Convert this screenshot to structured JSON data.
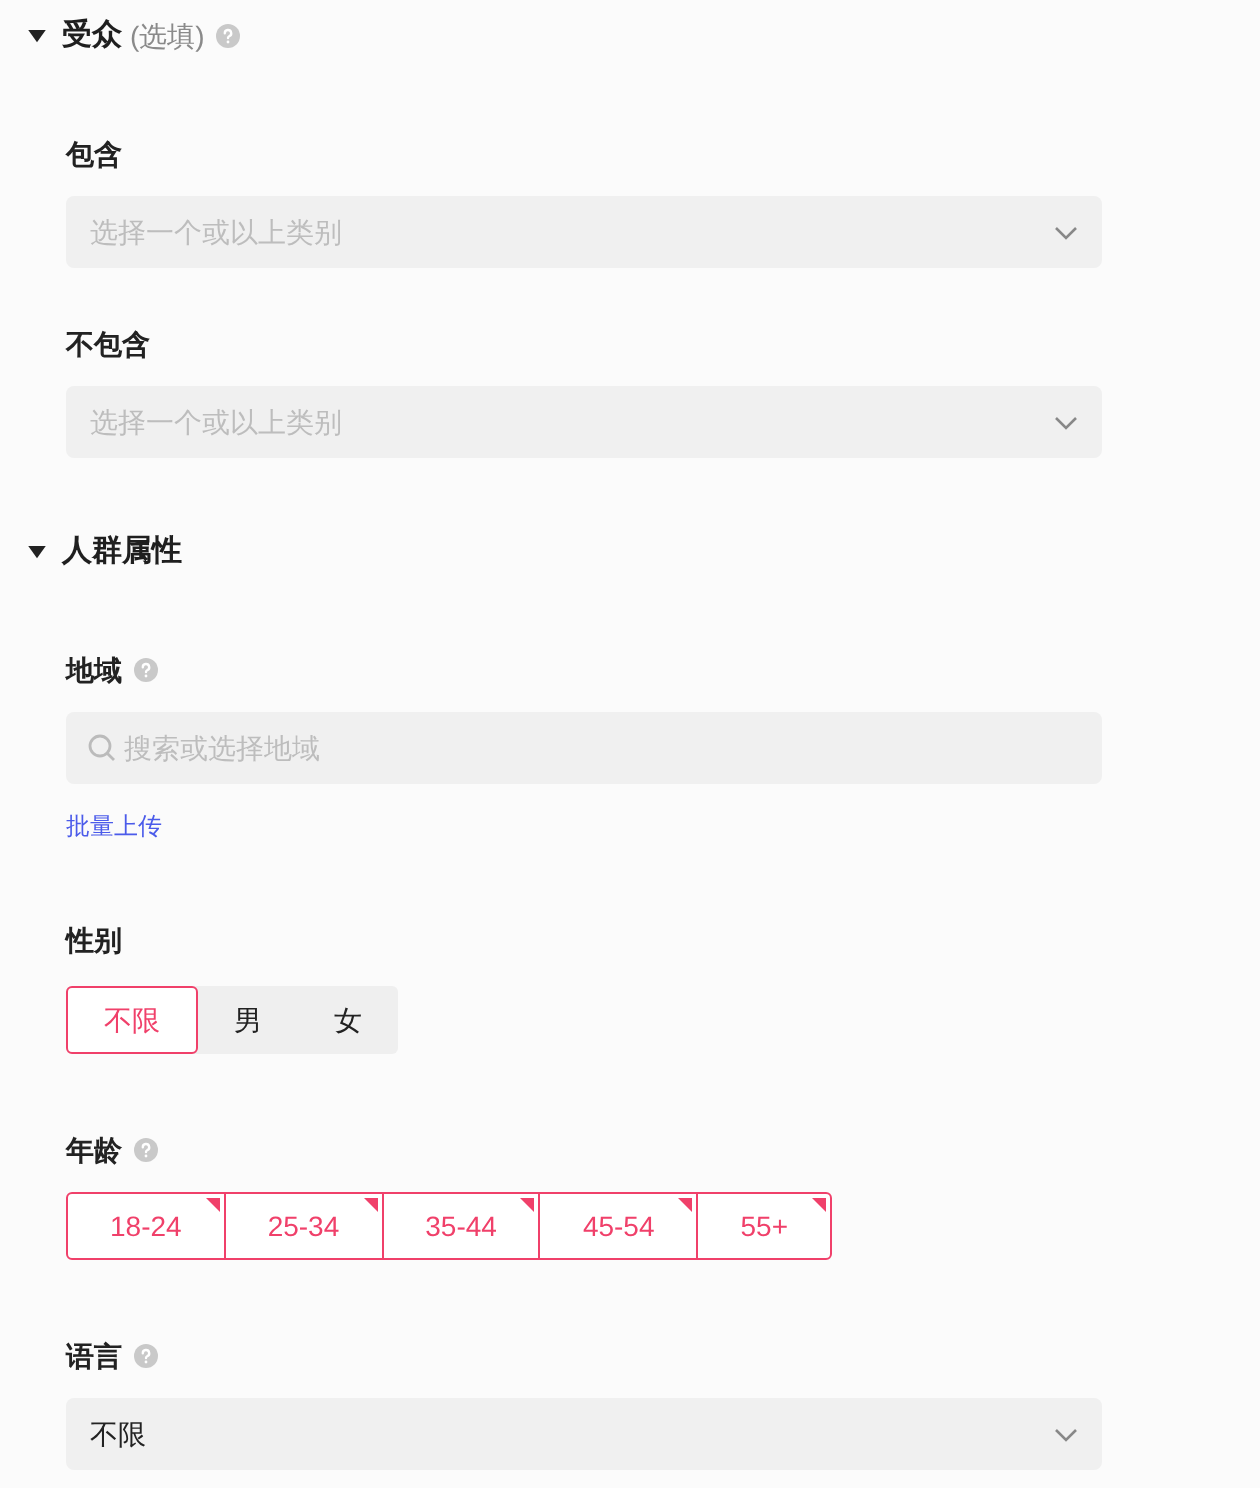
{
  "sections": [
    {
      "title": "受众",
      "note": "(选填)",
      "help": true,
      "expanded": true,
      "fields": [
        {
          "kind": "select",
          "label": "包含",
          "help": false,
          "placeholder": "选择一个或以上类别"
        },
        {
          "kind": "select",
          "label": "不包含",
          "help": false,
          "placeholder": "选择一个或以上类别"
        }
      ]
    },
    {
      "title": "人群属性",
      "help": false,
      "expanded": true,
      "fields": [
        {
          "kind": "search",
          "label": "地域",
          "help": true,
          "placeholder": "搜索或选择地域",
          "link": "批量上传"
        },
        {
          "kind": "segmented",
          "label": "性别",
          "help": false,
          "options": [
            {
              "label": "不限",
              "selected": true
            },
            {
              "label": "男",
              "selected": false
            },
            {
              "label": "女",
              "selected": false
            }
          ]
        },
        {
          "kind": "multi",
          "label": "年龄",
          "help": true,
          "options": [
            {
              "label": "18-24",
              "selected": true
            },
            {
              "label": "25-34",
              "selected": true
            },
            {
              "label": "35-44",
              "selected": true
            },
            {
              "label": "45-54",
              "selected": true
            },
            {
              "label": "55+",
              "selected": true
            }
          ]
        },
        {
          "kind": "select",
          "label": "语言",
          "help": true,
          "value": "不限"
        }
      ]
    }
  ]
}
